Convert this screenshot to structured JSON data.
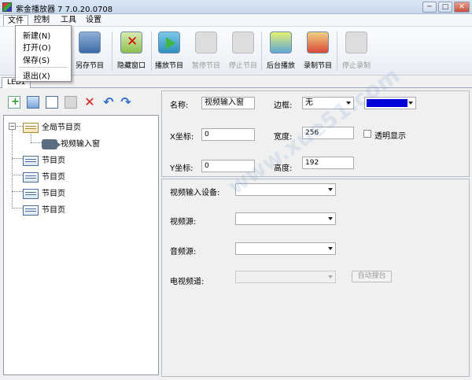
{
  "window": {
    "title": "紫金播放器 7 7.0.20.0708",
    "minimize": "─",
    "maximize": "□",
    "close": "✕"
  },
  "menubar": [
    "文件",
    "控制",
    "工具",
    "设置"
  ],
  "file_menu": {
    "items": [
      "新建(N)",
      "打开(O)",
      "保存(S)",
      "退出(X)"
    ]
  },
  "toolbar": {
    "save_as": "另存节目",
    "hide_window": "隐藏窗口",
    "play": "播放节目",
    "pause": "暂停节目",
    "stop": "停止节目",
    "background_play": "后台播放",
    "record": "录制节目",
    "stop_record": "停止录制"
  },
  "tab": {
    "label": "LED1"
  },
  "tree": {
    "global_page": "全局节目页",
    "video_input": "视频输入窗",
    "pages": [
      "节目页",
      "节目页",
      "节目页",
      "节目页",
      "节目页"
    ]
  },
  "props": {
    "name_label": "名称:",
    "name_value": "视频输入窗",
    "border_label": "边框:",
    "border_value": "无",
    "border_color": "#0000d8",
    "x_label": "X坐标:",
    "x_value": "0",
    "width_label": "宽度:",
    "width_value": "256",
    "transparent_label": "透明显示",
    "y_label": "Y坐标:",
    "y_value": "0",
    "height_label": "高度:",
    "height_value": "192"
  },
  "video": {
    "device_label": "视频输入设备:",
    "device_value": "",
    "source_label": "视频源:",
    "source_value": "",
    "audio_label": "音频源:",
    "audio_value": "",
    "channel_label": "电视频道:",
    "channel_value": "",
    "auto_search": "自动搜台"
  }
}
